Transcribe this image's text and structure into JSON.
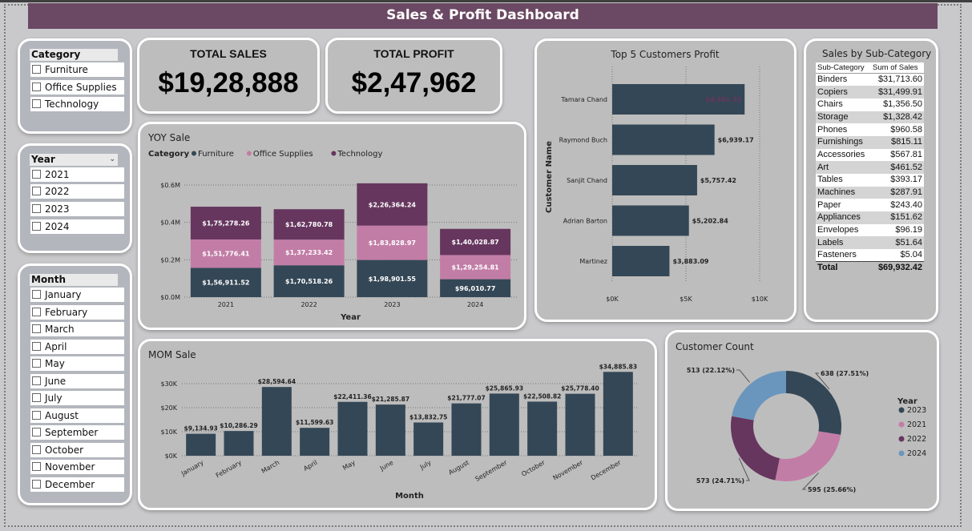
{
  "dashboard": {
    "title": "Sales & Profit Dashboard"
  },
  "colors": {
    "furniture": "#344756",
    "office_supplies": "#c27da6",
    "technology": "#66365f",
    "y2024": "#6a96bd",
    "title_bar": "#6b4863"
  },
  "slicers": {
    "category": {
      "title": "Category",
      "items": [
        "Furniture",
        "Office Supplies",
        "Technology"
      ]
    },
    "year": {
      "title": "Year",
      "items": [
        "2021",
        "2022",
        "2023",
        "2024"
      ]
    },
    "month": {
      "title": "Month",
      "items": [
        "January",
        "February",
        "March",
        "April",
        "May",
        "June",
        "July",
        "August",
        "September",
        "October",
        "November",
        "December"
      ]
    }
  },
  "kpis": {
    "sales": {
      "label": "TOTAL SALES",
      "value": "$19,28,888"
    },
    "profit": {
      "label": "TOTAL PROFIT",
      "value": "$2,47,962"
    }
  },
  "subcategory": {
    "title": "Sales by Sub-Category",
    "headers": [
      "Sub-Category",
      "Sum of Sales"
    ],
    "rows": [
      [
        "Binders",
        "$31,713.60"
      ],
      [
        "Copiers",
        "$31,499.91"
      ],
      [
        "Chairs",
        "$1,356.50"
      ],
      [
        "Storage",
        "$1,328.42"
      ],
      [
        "Phones",
        "$960.58"
      ],
      [
        "Furnishings",
        "$815.11"
      ],
      [
        "Accessories",
        "$567.81"
      ],
      [
        "Art",
        "$461.52"
      ],
      [
        "Tables",
        "$393.17"
      ],
      [
        "Machines",
        "$287.91"
      ],
      [
        "Paper",
        "$243.40"
      ],
      [
        "Appliances",
        "$151.62"
      ],
      [
        "Envelopes",
        "$96.19"
      ],
      [
        "Labels",
        "$51.64"
      ],
      [
        "Fasteners",
        "$5.04"
      ]
    ],
    "total_label": "Total",
    "total_value": "$69,932.42"
  },
  "chart_data": [
    {
      "id": "yoy",
      "type": "bar",
      "stacked": true,
      "title": "YOY Sale",
      "legend_title": "Category",
      "legend_position": "top-left",
      "xlabel": "Year",
      "ylabel": "",
      "categories": [
        "2021",
        "2022",
        "2023",
        "2024"
      ],
      "ylim": [
        0,
        600000
      ],
      "yticks": [
        0,
        200000,
        400000,
        600000
      ],
      "ytick_labels": [
        "$0.0M",
        "$0.2M",
        "$0.4M",
        "$0.6M"
      ],
      "grid": true,
      "series": [
        {
          "name": "Furniture",
          "color": "#344756",
          "values": [
            156911.52,
            170518.26,
            198901.55,
            96010.77
          ],
          "labels": [
            "$1,56,911.52",
            "$1,70,518.26",
            "$1,98,901.55",
            "$96,010.77"
          ]
        },
        {
          "name": "Office Supplies",
          "color": "#c27da6",
          "values": [
            151776.41,
            137233.42,
            183828.97,
            129254.81
          ],
          "labels": [
            "$1,51,776.41",
            "$1,37,233.42",
            "$1,83,828.97",
            "$1,29,254.81"
          ]
        },
        {
          "name": "Technology",
          "color": "#66365f",
          "values": [
            175278.26,
            162780.78,
            226364.24,
            140028.87
          ],
          "labels": [
            "$1,75,278.26",
            "$1,62,780.78",
            "$2,26,364.24",
            "$1,40,028.87"
          ]
        }
      ]
    },
    {
      "id": "top5",
      "type": "bar",
      "orientation": "horizontal",
      "title": "Top 5 Customers Profit",
      "xlabel": "",
      "ylabel": "Customer Name",
      "categories": [
        "Tamara Chand",
        "Raymond Buch",
        "Sanjit Chand",
        "Adrian Barton",
        "Martinez"
      ],
      "values": [
        8981.32,
        6939.17,
        5757.42,
        5202.84,
        3883.09
      ],
      "labels": [
        "$8,981.32",
        "$6,939.17",
        "$5,757.42",
        "$5,202.84",
        "$3,883.09"
      ],
      "xlim": [
        0,
        10000
      ],
      "xticks": [
        0,
        5000,
        10000
      ],
      "xtick_labels": [
        "$0K",
        "$5K",
        "$10K"
      ],
      "color": "#344756",
      "grid": true
    },
    {
      "id": "mom",
      "type": "bar",
      "title": "MOM Sale",
      "xlabel": "Month",
      "ylabel": "",
      "categories": [
        "January",
        "February",
        "March",
        "April",
        "May",
        "June",
        "July",
        "August",
        "September",
        "October",
        "November",
        "December"
      ],
      "values": [
        9134.93,
        10286.29,
        28594.64,
        11599.63,
        22411.36,
        21285.87,
        13832.75,
        21777.07,
        25865.93,
        22508.82,
        25778.4,
        34885.83
      ],
      "labels": [
        "$9,134.93",
        "$10,286.29",
        "$28,594.64",
        "$11,599.63",
        "$22,411.36",
        "$21,285.87",
        "$13,832.75",
        "$21,777.07",
        "$25,865.93",
        "$22,508.82",
        "$25,778.40",
        "$34,885.83"
      ],
      "ylim": [
        0,
        35000
      ],
      "yticks": [
        0,
        10000,
        20000,
        30000
      ],
      "ytick_labels": [
        "$0K",
        "$10K",
        "$20K",
        "$30K"
      ],
      "color": "#344756",
      "grid": true
    },
    {
      "id": "customer_count",
      "type": "pie",
      "donut": true,
      "title": "Customer Count",
      "legend_title": "Year",
      "legend_position": "right",
      "categories": [
        "2023",
        "2021",
        "2022",
        "2024"
      ],
      "values": [
        638,
        595,
        573,
        513
      ],
      "labels": [
        "638 (27.51%)",
        "595 (25.66%)",
        "573 (24.71%)",
        "513 (22.12%)"
      ],
      "colors": [
        "#344756",
        "#c27da6",
        "#66365f",
        "#6a96bd"
      ]
    }
  ]
}
